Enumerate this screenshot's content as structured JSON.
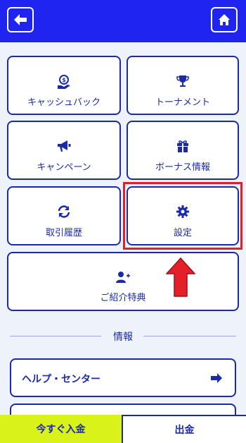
{
  "header": {
    "back_icon": "arrow-left-icon",
    "home_icon": "home-icon"
  },
  "menu": {
    "items": [
      {
        "label": "キャッシュバック",
        "icon": "cashback-icon"
      },
      {
        "label": "トーナメント",
        "icon": "trophy-icon"
      },
      {
        "label": "キャンペーン",
        "icon": "megaphone-icon"
      },
      {
        "label": "ボーナス情報",
        "icon": "gift-icon"
      },
      {
        "label": "取引履歴",
        "icon": "refresh-icon"
      },
      {
        "label": "設定",
        "icon": "gear-icon"
      },
      {
        "label": "ご紹介特典",
        "icon": "add-user-icon"
      }
    ]
  },
  "info": {
    "section_title": "情報",
    "help_label": "ヘルプ・センター"
  },
  "bottom_bar": {
    "deposit_label": "今すぐ入金",
    "withdraw_label": "出金"
  },
  "colors": {
    "header": "#1f24f0",
    "accent": "#1a2aa8",
    "highlight": "#e3202a",
    "deposit": "#d8f21a"
  }
}
